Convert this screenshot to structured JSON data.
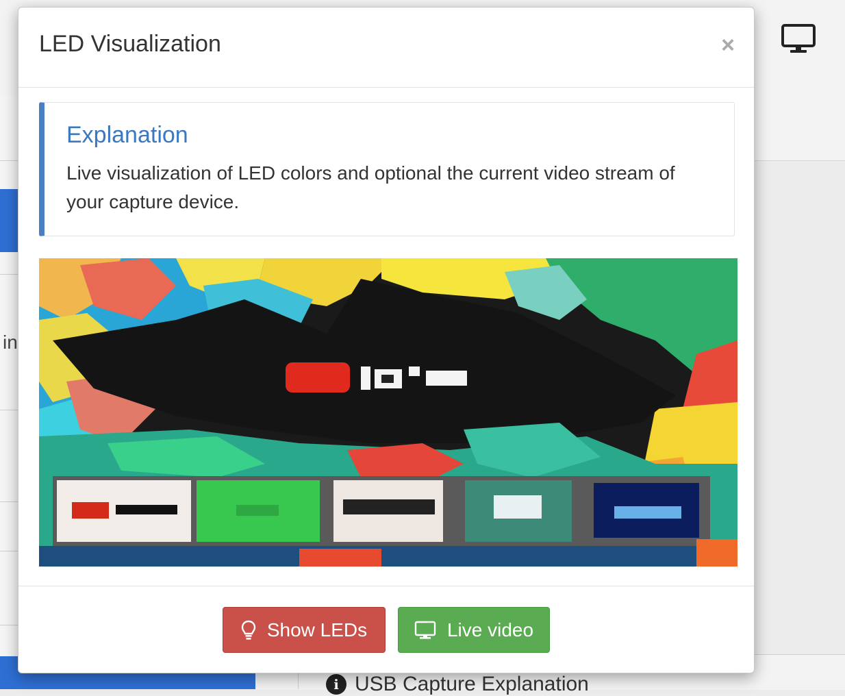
{
  "modal": {
    "title": "LED Visualization",
    "close_label": "×",
    "explanation": {
      "title": "Explanation",
      "text": "Live visualization of LED colors and optional the current video stream of your capture device."
    },
    "buttons": {
      "show_leds": "Show LEDs",
      "live_video": "Live video"
    }
  },
  "background": {
    "left_text": "in",
    "bottom_panel_title": "USB Capture Explanation",
    "info_glyph": "i"
  },
  "icons": {
    "bulb": "lightbulb-icon",
    "monitor": "monitor-icon",
    "info": "info-circle-icon"
  },
  "colors": {
    "accent_blue": "#3a78c2",
    "callout_border": "#4a7fc4",
    "btn_red": "#c9514a",
    "btn_green": "#5aab52",
    "sidebar_blue": "#2f6fd4"
  }
}
